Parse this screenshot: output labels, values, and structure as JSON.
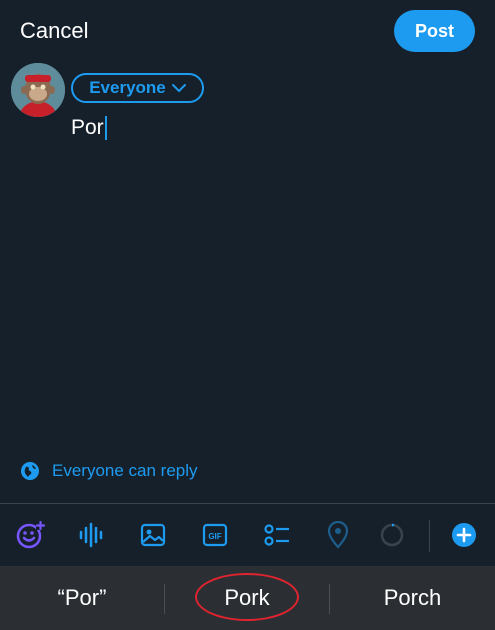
{
  "header": {
    "cancel_label": "Cancel",
    "post_label": "Post"
  },
  "composer": {
    "audience_label": "Everyone",
    "text": "Por"
  },
  "reply_setting": {
    "label": "Everyone can reply"
  },
  "toolbar": {
    "icons": [
      "grok-icon",
      "audio-waveform-icon",
      "image-icon",
      "gif-icon",
      "poll-icon",
      "location-icon",
      "progress-ring-icon",
      "add-thread-icon"
    ]
  },
  "suggestions": [
    "“Por”",
    "Pork",
    "Porch"
  ],
  "colors": {
    "background": "#16202b",
    "accent": "#1d9bf0",
    "suggestion_bar": "#2b2f34",
    "highlight_circle": "#e0242f"
  }
}
